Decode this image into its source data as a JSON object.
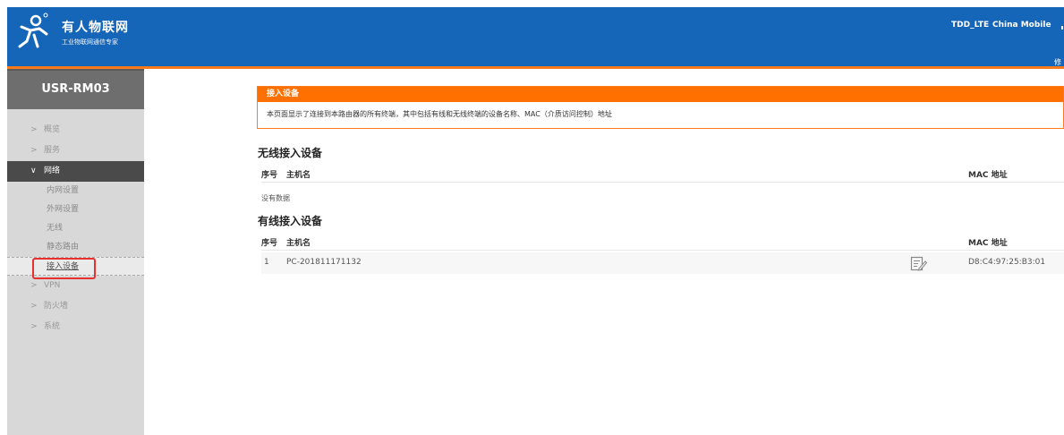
{
  "header": {
    "brand_name": "有人物联网",
    "brand_subtitle": "工业物联网通信专家",
    "network_type": "TDD_LTE",
    "operator": "China Mobile",
    "modify_link": "修改",
    "colors": {
      "header_bg": "#1565b8",
      "accent": "#ff7a1a"
    },
    "icons": [
      "brand-logo-icon",
      "signal-strength-icon"
    ]
  },
  "sidebar": {
    "device_name": "USR-RM03",
    "menu": [
      {
        "label": "概览",
        "expanded": false
      },
      {
        "label": "服务",
        "expanded": false
      },
      {
        "label": "网络",
        "expanded": true,
        "children": [
          "内网设置",
          "外网设置",
          "无线",
          "静态路由",
          "接入设备"
        ]
      },
      {
        "label": "VPN",
        "expanded": false
      },
      {
        "label": "防火墙",
        "expanded": false
      },
      {
        "label": "系统",
        "expanded": false
      }
    ],
    "selected": "接入设备"
  },
  "main": {
    "panel": {
      "title": "接入设备",
      "description": "本页面显示了连接到本路由器的所有终端，其中包括有线和无线终端的设备名称、MAC（介质访问控制）地址"
    },
    "wireless": {
      "title": "无线接入设备",
      "columns": {
        "no": "序号",
        "host": "主机名",
        "mac": "MAC 地址"
      },
      "empty_text": "没有数据"
    },
    "wired": {
      "title": "有线接入设备",
      "columns": {
        "no": "序号",
        "host": "主机名",
        "mac": "MAC 地址"
      },
      "rows": [
        {
          "no": "1",
          "host": "PC-201811171132",
          "mac": "D8:C4:97:25:B3:01",
          "icon": "edit-icon"
        }
      ]
    }
  }
}
